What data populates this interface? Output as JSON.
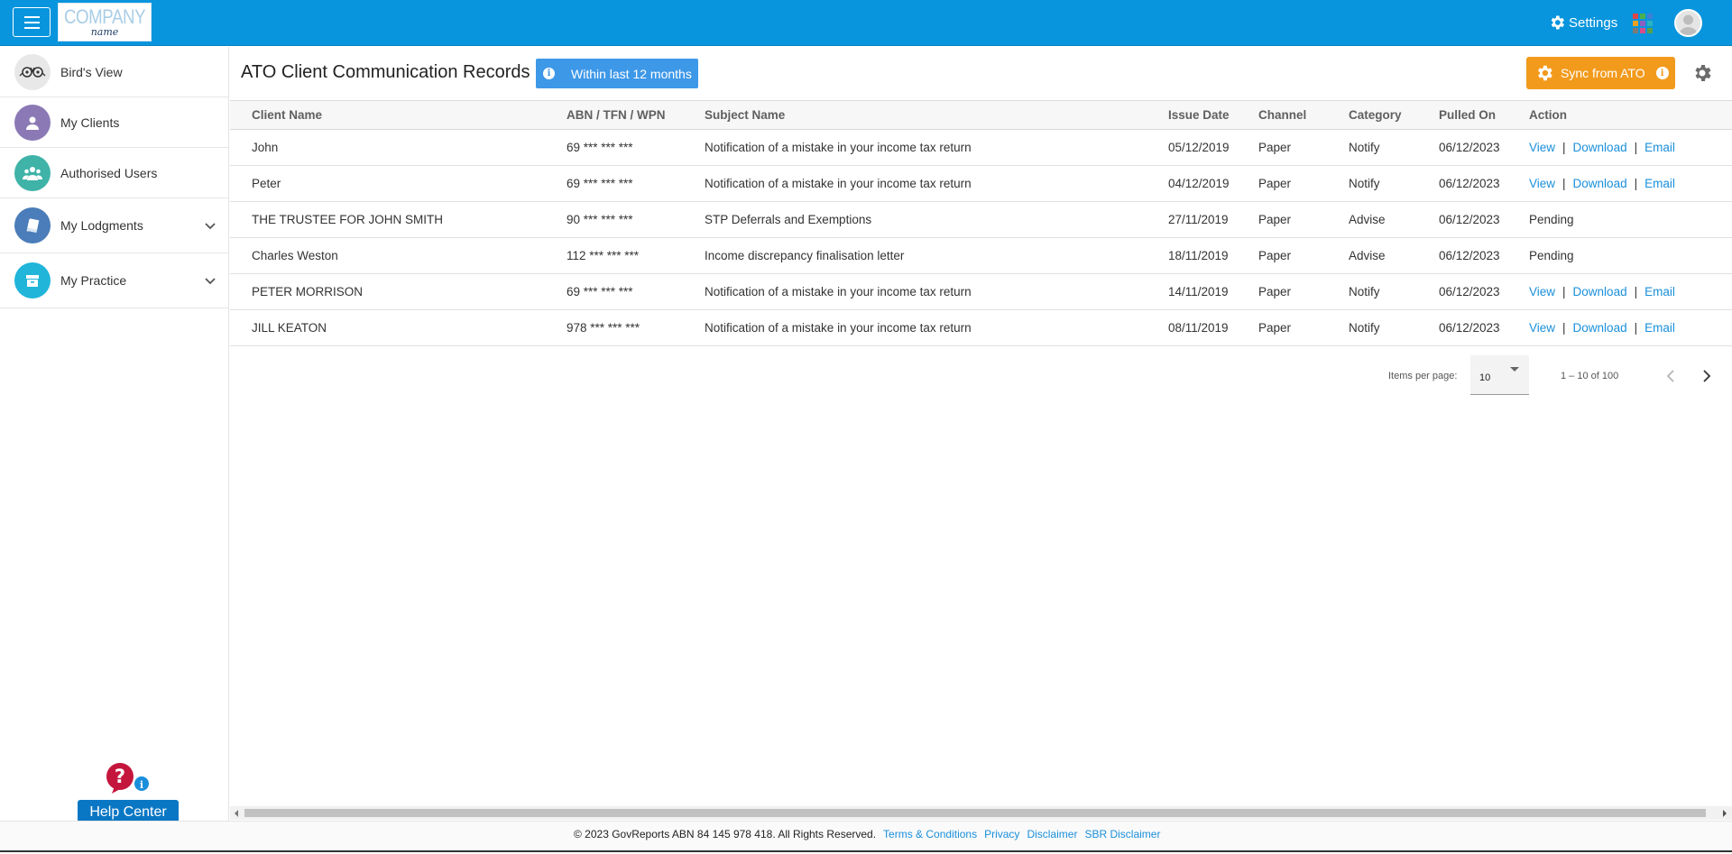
{
  "header": {
    "logo_line1": "COMPANY",
    "logo_line2": "name",
    "settings_label": "Settings",
    "icons": [
      "menu-icon",
      "gear-icon",
      "apps-grid-icon",
      "user-avatar-icon"
    ]
  },
  "sidebar": {
    "items": [
      {
        "label": "Bird's View",
        "icon": "owl-icon",
        "color": "#e8e8e8"
      },
      {
        "label": "My Clients",
        "icon": "user-icon",
        "color": "#8a79b5"
      },
      {
        "label": "Authorised Users",
        "icon": "users-icon",
        "color": "#3fb3a7"
      },
      {
        "label": "My Lodgments",
        "icon": "book-icon",
        "color": "#4a7db9"
      },
      {
        "label": "My Practice",
        "icon": "archive-icon",
        "color": "#20b5d9"
      }
    ],
    "help_label": "Help Center"
  },
  "main": {
    "title": "ATO Client Communication Records",
    "filter_badge": "Within last 12 months",
    "sync_label": "Sync from ATO",
    "accent_blue": "#0895dd",
    "sync_color": "#f29a1c"
  },
  "table": {
    "headers": [
      "Client Name",
      "ABN / TFN / WPN",
      "Subject Name",
      "Issue Date",
      "Channel",
      "Category",
      "Pulled On",
      "Action"
    ],
    "rows": [
      {
        "client": "John",
        "id": "69 *** *** ***",
        "subject": "Notification of a mistake in your income tax return",
        "issue": "05/12/2019",
        "channel": "Paper",
        "category": "Notify",
        "pulled": "06/12/2023",
        "actions": [
          "View",
          "Download",
          "Email"
        ],
        "status": ""
      },
      {
        "client": "Peter",
        "id": "69 *** *** ***",
        "subject": "Notification of a mistake in your income tax return",
        "issue": "04/12/2019",
        "channel": "Paper",
        "category": "Notify",
        "pulled": "06/12/2023",
        "actions": [
          "View",
          "Download",
          "Email"
        ],
        "status": ""
      },
      {
        "client": "THE TRUSTEE FOR JOHN SMITH",
        "id": "90 *** *** ***",
        "subject": "STP Deferrals and Exemptions",
        "issue": "27/11/2019",
        "channel": "Paper",
        "category": "Advise",
        "pulled": "06/12/2023",
        "actions": [],
        "status": "Pending"
      },
      {
        "client": "Charles Weston",
        "id": "112 *** *** ***",
        "subject": "Income discrepancy finalisation letter",
        "issue": "18/11/2019",
        "channel": "Paper",
        "category": "Advise",
        "pulled": "06/12/2023",
        "actions": [],
        "status": "Pending"
      },
      {
        "client": "PETER MORRISON",
        "id": "69 *** *** ***",
        "subject": "Notification of a mistake in your income tax return",
        "issue": "14/11/2019",
        "channel": "Paper",
        "category": "Notify",
        "pulled": "06/12/2023",
        "actions": [
          "View",
          "Download",
          "Email"
        ],
        "status": ""
      },
      {
        "client": "JILL KEATON",
        "id": "978 *** *** ***",
        "subject": "Notification of a mistake in your income tax return",
        "issue": "08/11/2019",
        "channel": "Paper",
        "category": "Notify",
        "pulled": "06/12/2023",
        "actions": [
          "View",
          "Download",
          "Email"
        ],
        "status": ""
      }
    ]
  },
  "paginator": {
    "label": "Items per page:",
    "page_size": "10",
    "range": "1 – 10 of 100"
  },
  "footer": {
    "copyright": "© 2023 GovReports ABN 84 145 978 418. All Rights Reserved.",
    "links": [
      "Terms & Conditions",
      "Privacy",
      "Disclaimer",
      "SBR Disclaimer"
    ]
  }
}
